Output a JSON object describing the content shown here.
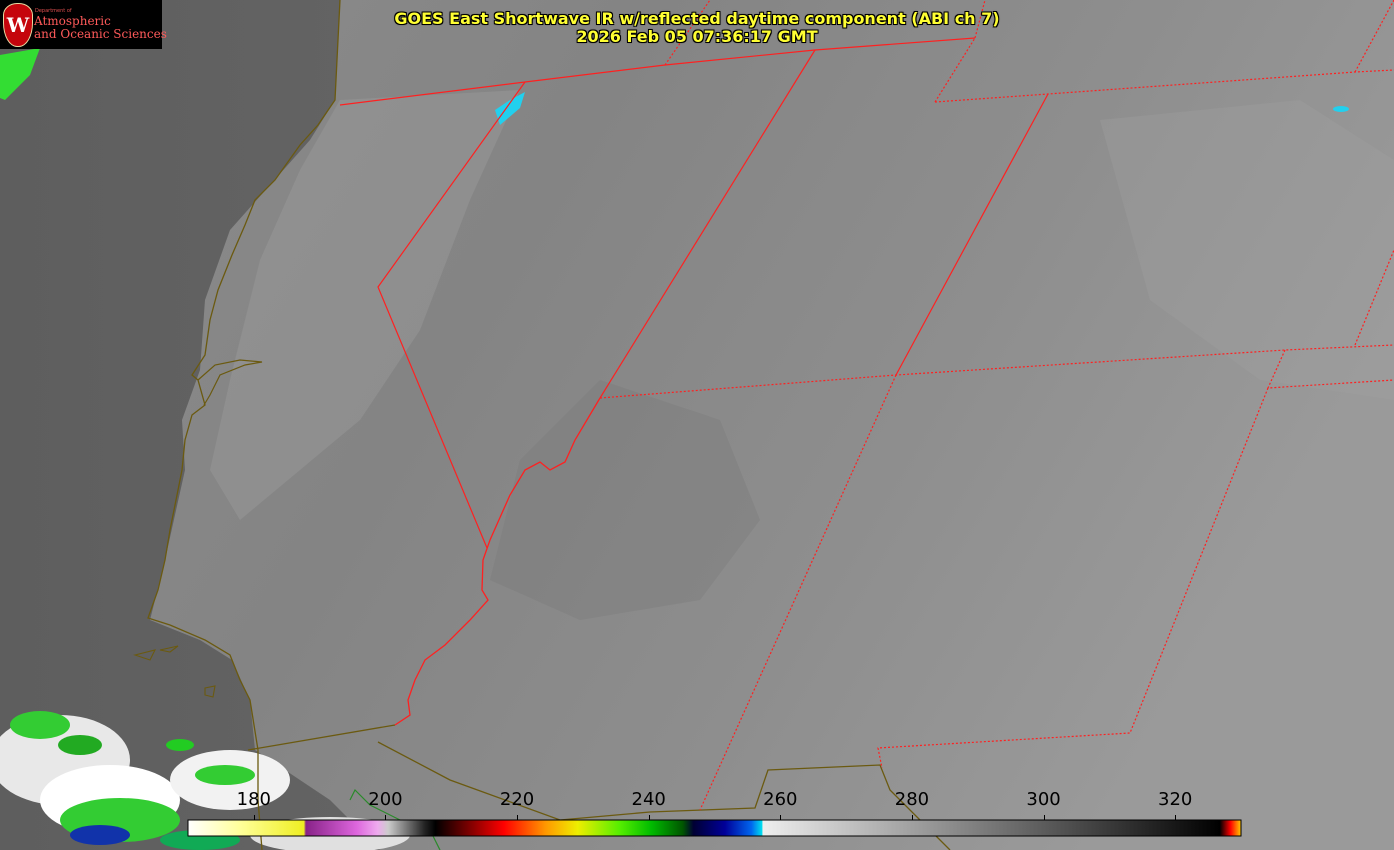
{
  "title": {
    "line1": "GOES East Shortwave IR w/reflected daytime component (ABI ch 7)",
    "line2": "2026 Feb 05 07:36:17 GMT"
  },
  "logo": {
    "department": "Department of",
    "line1": "Atmospheric",
    "line2": "and Oceanic Sciences",
    "crest_letter": "W"
  },
  "colorbar": {
    "min": 170,
    "max": 330,
    "ticks": [
      "180",
      "200",
      "220",
      "240",
      "260",
      "280",
      "300",
      "320"
    ],
    "tick_values": [
      180,
      200,
      220,
      240,
      260,
      280,
      300,
      320
    ]
  },
  "colors": {
    "title": "#ffff33",
    "state_borders": "#ff2020",
    "coastline": "#6b5a10"
  }
}
